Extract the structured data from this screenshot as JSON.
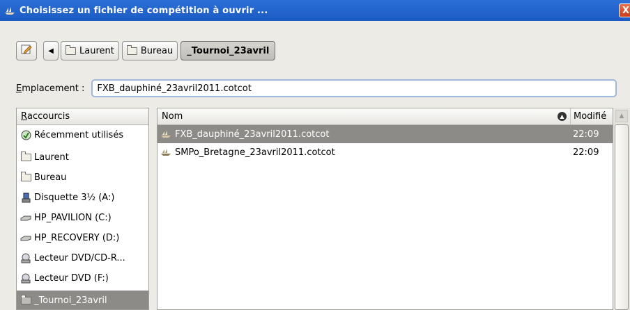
{
  "window": {
    "title": "Choisissez un fichier de compétition à ouvrir ...",
    "close_label": "X",
    "title_icon": "ship-icon"
  },
  "toolbar": {
    "edit_icon": "edit-note-icon",
    "back_label": "◀",
    "breadcrumbs": [
      {
        "label": "Laurent"
      },
      {
        "label": "Bureau"
      },
      {
        "label": "_Tournoi_23avril",
        "active": true
      }
    ]
  },
  "location": {
    "label_underlined": "E",
    "label_rest": "mplacement :",
    "value": "FXB_dauphiné_23avril2011.cotcot"
  },
  "sidebar": {
    "header_underlined": "R",
    "header_rest": "accourcis",
    "items": [
      {
        "label": "Récemment utilisés",
        "icon": "recent-icon"
      },
      {
        "label": "Laurent",
        "icon": "folder-icon"
      },
      {
        "label": "Bureau",
        "icon": "folder-icon"
      },
      {
        "label": "Disquette 3½ (A:)",
        "icon": "floppy-icon"
      },
      {
        "label": "HP_PAVILION (C:)",
        "icon": "harddisk-icon"
      },
      {
        "label": "HP_RECOVERY (D:)",
        "icon": "harddisk-icon"
      },
      {
        "label": "Lecteur DVD/CD-R...",
        "icon": "optical-drive-icon"
      },
      {
        "label": "Lecteur DVD (F:)",
        "icon": "optical-drive-icon"
      },
      {
        "label": "_Tournoi_23avril",
        "icon": "folder-icon",
        "selected": true
      }
    ]
  },
  "filelist": {
    "columns": {
      "name": "Nom",
      "modified": "Modifié"
    },
    "sort_icon": "sort-ascending-icon",
    "rows": [
      {
        "name": "FXB_dauphiné_23avril2011.cotcot",
        "modified": "22:09",
        "selected": true
      },
      {
        "name": "SMPo_Bretagne_23avril2011.cotcot",
        "modified": "22:09",
        "selected": false
      }
    ]
  },
  "colors": {
    "titlebar": "#1a5bc4",
    "selection": "#8c8b87",
    "close_button": "#d9502b"
  }
}
